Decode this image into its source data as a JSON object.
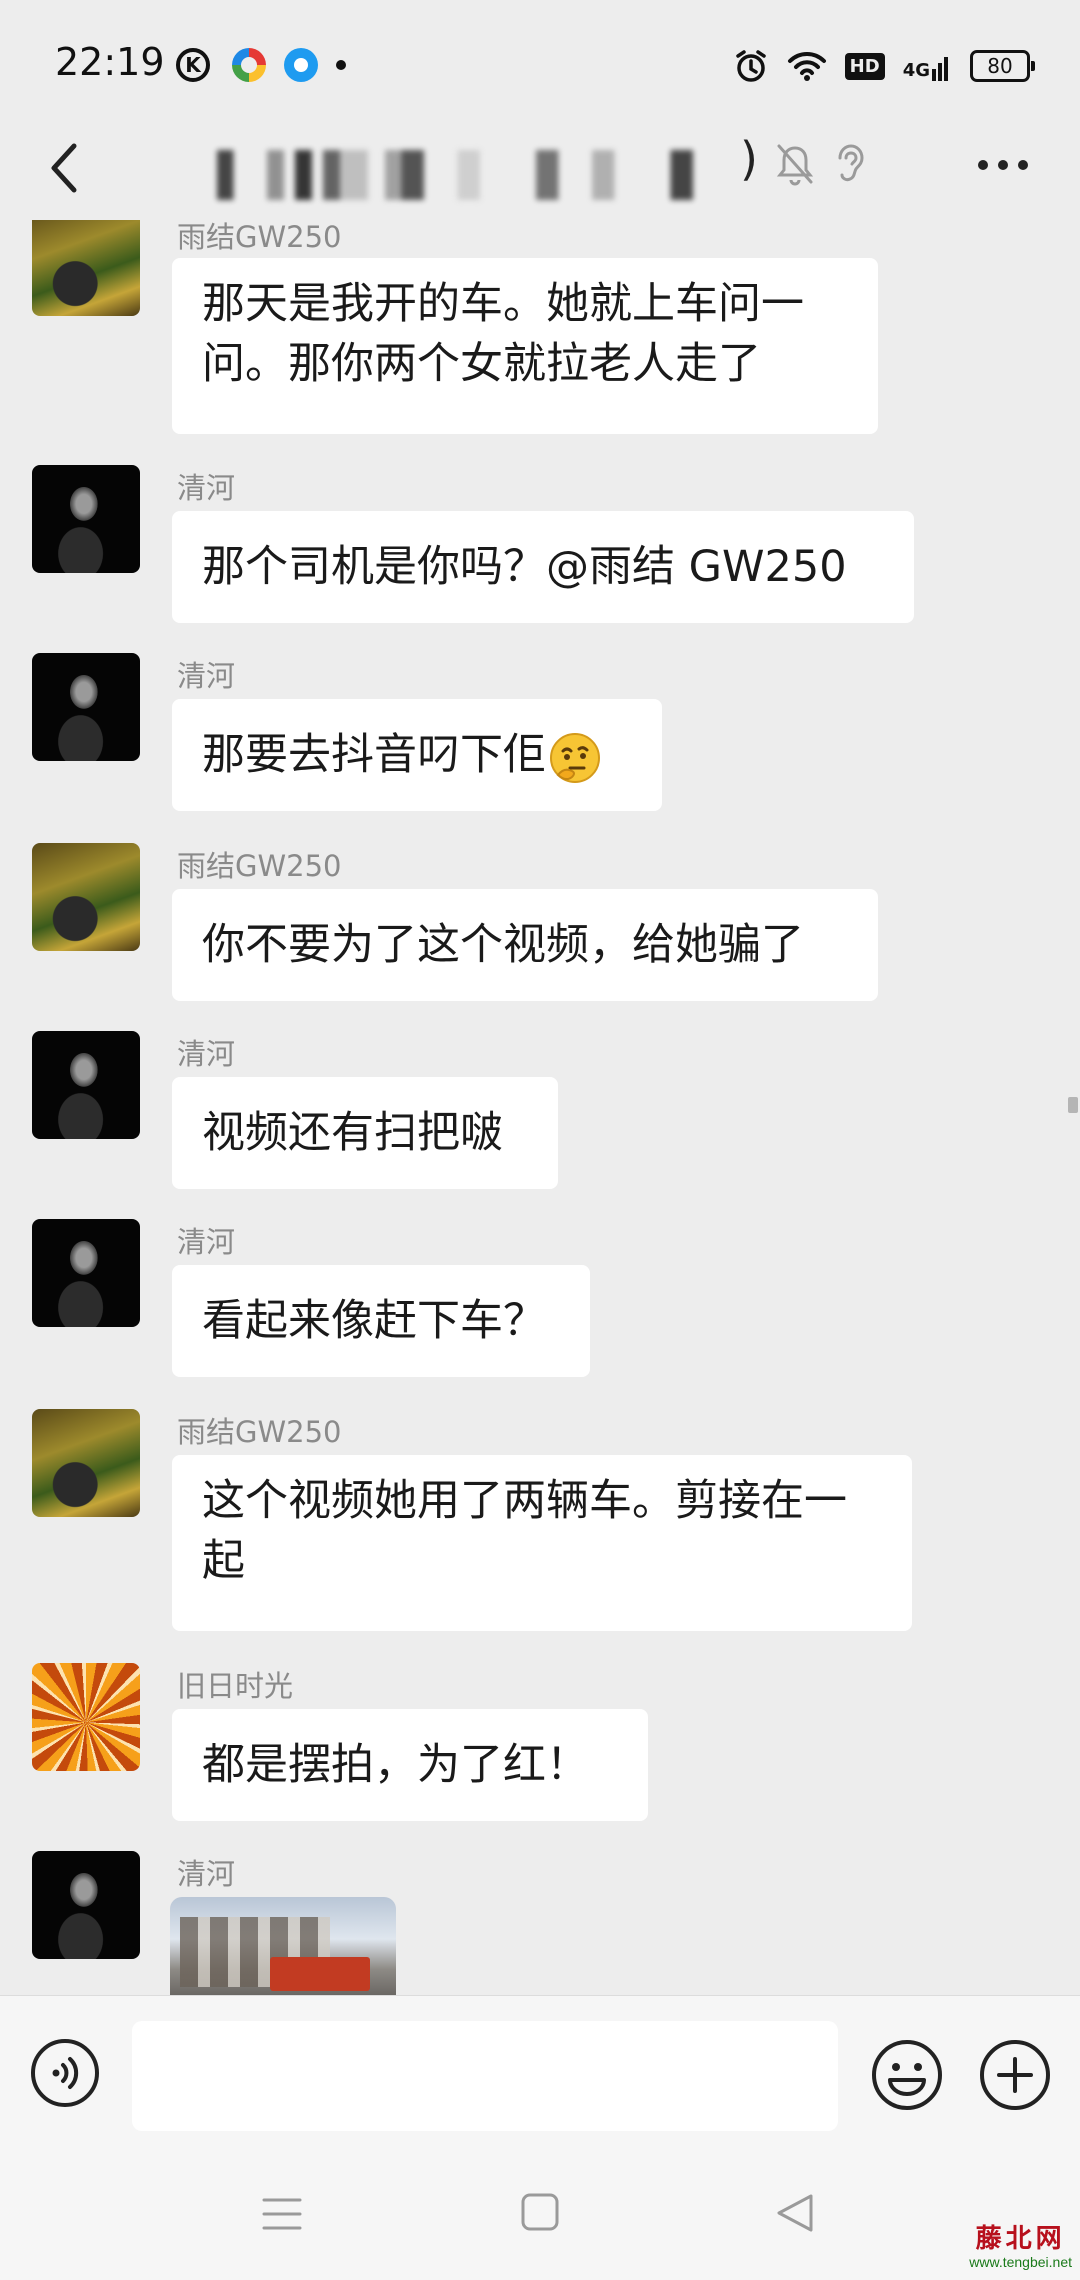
{
  "status_bar": {
    "time": "22:19",
    "app_k_label": "K",
    "hd_label": "HD",
    "network_label": "4G",
    "battery_level": "80",
    "icons": [
      "k-app-icon",
      "colorful-app-icon",
      "blue-app-icon",
      "alarm-icon",
      "wifi-icon",
      "signal-icon",
      "battery-icon"
    ]
  },
  "title_bar": {
    "title_close_paren": ")",
    "icons": [
      "back-icon",
      "mute-icon",
      "ear-icon",
      "more-icon"
    ]
  },
  "messages": [
    {
      "sender": "雨结GW250",
      "lines": [
        "那天是我开的车。她就上车问一",
        "问。那你两个女就拉老人走了"
      ]
    },
    {
      "sender": "清河",
      "text": "那个司机是你吗？@雨结 GW250"
    },
    {
      "sender": "清河",
      "text": "那要去抖音叼下佢",
      "emoji": "thinking-face-emoji"
    },
    {
      "sender": "雨结GW250",
      "text": "你不要为了这个视频，给她骗了"
    },
    {
      "sender": "清河",
      "text": "视频还有扫把啵"
    },
    {
      "sender": "清河",
      "text": "看起来像赶下车？"
    },
    {
      "sender": "雨结GW250",
      "lines": [
        "这个视频她用了两辆车。剪接在一",
        "起"
      ]
    },
    {
      "sender": "旧日时光",
      "text": "都是摆拍，为了红！"
    },
    {
      "sender": "清河",
      "image": "street-photo-thumbnail"
    }
  ],
  "input_bar": {
    "placeholder": "",
    "icons": [
      "voice-icon",
      "emoji-icon",
      "plus-icon"
    ]
  },
  "nav_bar": {
    "icons": [
      "menu-icon",
      "home-icon",
      "back-triangle-icon"
    ]
  },
  "watermark": {
    "title": "藤北网",
    "url": "www.tengbei.net"
  }
}
